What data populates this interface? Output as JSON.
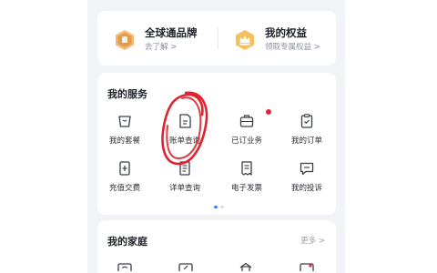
{
  "equity": {
    "brand": {
      "title": "全球通品牌",
      "sub": "去了解 >"
    },
    "rights": {
      "title": "我的权益",
      "sub": "领取专属权益 >"
    }
  },
  "services": {
    "title": "我的服务",
    "items": [
      {
        "label": "我的套餐",
        "icon": "bag-icon"
      },
      {
        "label": "账单查询",
        "icon": "bill-icon"
      },
      {
        "label": "已订业务",
        "icon": "briefcase-icon",
        "badge": true
      },
      {
        "label": "我的订单",
        "icon": "clipboard-icon"
      },
      {
        "label": "充值交费",
        "icon": "recharge-icon"
      },
      {
        "label": "详单查询",
        "icon": "detail-list-icon"
      },
      {
        "label": "电子发票",
        "icon": "invoice-icon"
      },
      {
        "label": "我的投诉",
        "icon": "complaint-icon"
      }
    ]
  },
  "family": {
    "title": "我的家庭",
    "more": "更多 >"
  },
  "colors": {
    "accent": "#3b7cf6",
    "badge": "#e0283a",
    "annotation": "#e0232e",
    "gold": "#e8a34a"
  }
}
